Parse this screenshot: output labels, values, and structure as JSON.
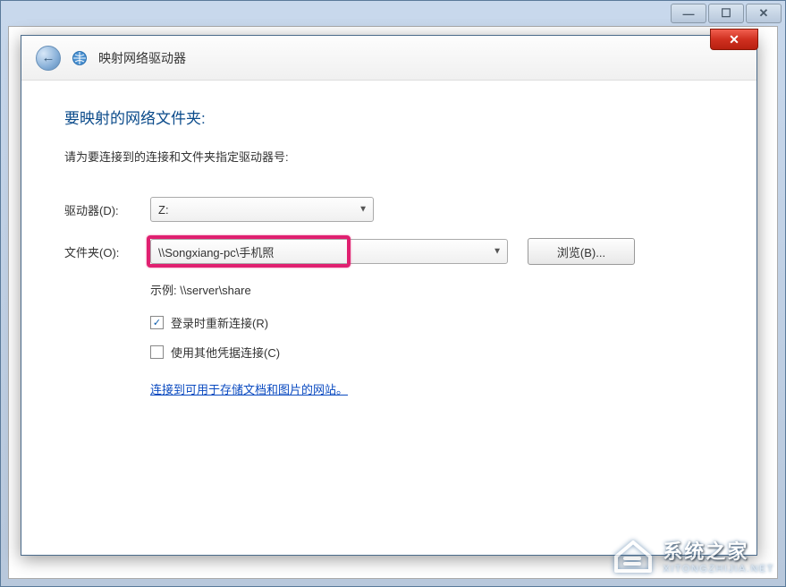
{
  "outer_window": {
    "minimize": "—",
    "maximize": "☐",
    "close": "✕"
  },
  "dialog": {
    "close": "✕",
    "back_arrow": "←",
    "title": "映射网络驱动器",
    "heading": "要映射的网络文件夹:",
    "instruction": "请为要连接到的连接和文件夹指定驱动器号:",
    "drive_label": "驱动器(D):",
    "drive_value": "Z:",
    "folder_label": "文件夹(O):",
    "folder_value": "\\\\Songxiang-pc\\手机照",
    "browse_label": "浏览(B)...",
    "example_text": "示例: \\\\server\\share",
    "checkbox_reconnect": "登录时重新连接(R)",
    "checkbox_reconnect_checked": "✓",
    "checkbox_credentials": "使用其他凭据连接(C)",
    "link_text": "连接到可用于存储文档和图片的网站。"
  },
  "watermark": {
    "cn": "系统之家",
    "en": "XITONGZHIJIA.NET"
  }
}
